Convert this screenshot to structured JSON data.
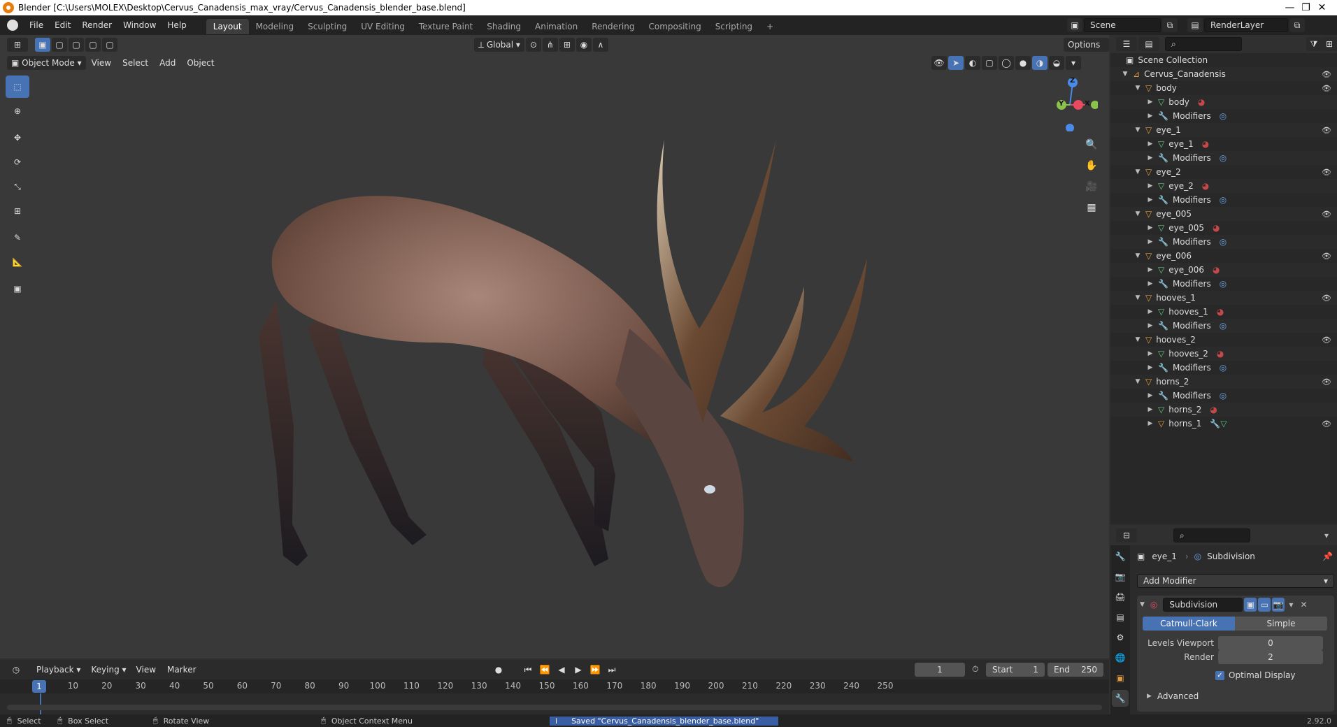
{
  "window": {
    "title": "Blender [C:\\Users\\MOLEX\\Desktop\\Cervus_Canadensis_max_vray/Cervus_Canadensis_blender_base.blend]",
    "minimize": "—",
    "maximize": "❐",
    "close": "✕"
  },
  "menu": [
    "File",
    "Edit",
    "Render",
    "Window",
    "Help"
  ],
  "workspaces": [
    "Layout",
    "Modeling",
    "Sculpting",
    "UV Editing",
    "Texture Paint",
    "Shading",
    "Animation",
    "Rendering",
    "Compositing",
    "Scripting"
  ],
  "active_workspace": "Layout",
  "add_workspace": "+",
  "scene": {
    "name": "Scene",
    "render_layer": "RenderLayer"
  },
  "viewport": {
    "transform_orientation": "Global",
    "options_label": "Options",
    "mode": "Object Mode",
    "menus": [
      "View",
      "Select",
      "Add",
      "Object"
    ],
    "gizmo_axes": {
      "z": "Z",
      "y": "Y",
      "x": "X"
    }
  },
  "outliner": {
    "root": "Scene Collection",
    "rows": [
      {
        "label": "Cervus_Canadensis",
        "indent": 0,
        "kind": "collection",
        "eye": true
      },
      {
        "label": "body",
        "indent": 1,
        "kind": "object",
        "eye": true
      },
      {
        "label": "body",
        "indent": 2,
        "kind": "mesh",
        "extra": "material"
      },
      {
        "label": "Modifiers",
        "indent": 2,
        "kind": "modifiers",
        "extra": "modifier"
      },
      {
        "label": "eye_1",
        "indent": 1,
        "kind": "object",
        "eye": true
      },
      {
        "label": "eye_1",
        "indent": 2,
        "kind": "mesh",
        "extra": "material"
      },
      {
        "label": "Modifiers",
        "indent": 2,
        "kind": "modifiers",
        "extra": "modifier"
      },
      {
        "label": "eye_2",
        "indent": 1,
        "kind": "object",
        "eye": true
      },
      {
        "label": "eye_2",
        "indent": 2,
        "kind": "mesh",
        "extra": "material"
      },
      {
        "label": "Modifiers",
        "indent": 2,
        "kind": "modifiers",
        "extra": "modifier"
      },
      {
        "label": "eye_005",
        "indent": 1,
        "kind": "object",
        "eye": true
      },
      {
        "label": "eye_005",
        "indent": 2,
        "kind": "mesh",
        "extra": "material"
      },
      {
        "label": "Modifiers",
        "indent": 2,
        "kind": "modifiers",
        "extra": "modifier"
      },
      {
        "label": "eye_006",
        "indent": 1,
        "kind": "object",
        "eye": true
      },
      {
        "label": "eye_006",
        "indent": 2,
        "kind": "mesh",
        "extra": "material"
      },
      {
        "label": "Modifiers",
        "indent": 2,
        "kind": "modifiers",
        "extra": "modifier"
      },
      {
        "label": "hooves_1",
        "indent": 1,
        "kind": "object",
        "eye": true
      },
      {
        "label": "hooves_1",
        "indent": 2,
        "kind": "mesh",
        "extra": "material"
      },
      {
        "label": "Modifiers",
        "indent": 2,
        "kind": "modifiers",
        "extra": "modifier"
      },
      {
        "label": "hooves_2",
        "indent": 1,
        "kind": "object",
        "eye": true
      },
      {
        "label": "hooves_2",
        "indent": 2,
        "kind": "mesh",
        "extra": "material"
      },
      {
        "label": "Modifiers",
        "indent": 2,
        "kind": "modifiers",
        "extra": "modifier"
      },
      {
        "label": "horns_2",
        "indent": 1,
        "kind": "object",
        "eye": true
      },
      {
        "label": "Modifiers",
        "indent": 2,
        "kind": "modifiers",
        "extra": "modifier"
      },
      {
        "label": "horns_2",
        "indent": 2,
        "kind": "mesh",
        "extra": "material"
      },
      {
        "label": "horns_1",
        "indent": 2,
        "kind": "object",
        "eye": true,
        "extra": "wrench-mesh"
      }
    ]
  },
  "properties": {
    "breadcrumb_object": "eye_1",
    "breadcrumb_modifier": "Subdivision",
    "add_modifier": "Add Modifier",
    "modifier_name": "Subdivision",
    "algo_catmull": "Catmull-Clark",
    "algo_simple": "Simple",
    "active_algo": "Catmull-Clark",
    "levels_viewport_label": "Levels Viewport",
    "levels_viewport_value": "0",
    "render_label": "Render",
    "render_value": "2",
    "optimal_display_label": "Optimal Display",
    "optimal_display_checked": true,
    "advanced_label": "Advanced"
  },
  "timeline": {
    "menus": [
      "Playback",
      "Keying",
      "View",
      "Marker"
    ],
    "current_frame": "1",
    "start_label": "Start",
    "start_value": "1",
    "end_label": "End",
    "end_value": "250",
    "ticks": [
      "10",
      "20",
      "30",
      "40",
      "50",
      "60",
      "70",
      "80",
      "90",
      "100",
      "110",
      "120",
      "130",
      "140",
      "150",
      "160",
      "170",
      "180",
      "190",
      "200",
      "210",
      "220",
      "230",
      "240",
      "250"
    ],
    "playhead_label": "1"
  },
  "status": {
    "select": "Select",
    "box_select": "Box Select",
    "rotate_view": "Rotate View",
    "context_menu": "Object Context Menu",
    "message": "Saved \"Cervus_Canadensis_blender_base.blend\"",
    "version": "2.92.0"
  },
  "colors": {
    "accent": "#4772b3",
    "object_orange": "#e09a3c",
    "mesh_green": "#5cc47a",
    "material_red": "#c6484a",
    "modifier_blue": "#6aa2e6"
  }
}
